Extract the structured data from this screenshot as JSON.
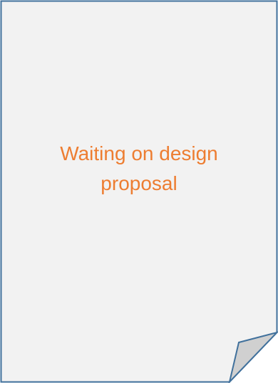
{
  "document": {
    "message": "Waiting on design proposal"
  },
  "colors": {
    "paper_fill": "#F2F2F2",
    "paper_border": "#41719C",
    "fold_fill": "#D0D0D0",
    "message_text": "#ED7D31"
  }
}
